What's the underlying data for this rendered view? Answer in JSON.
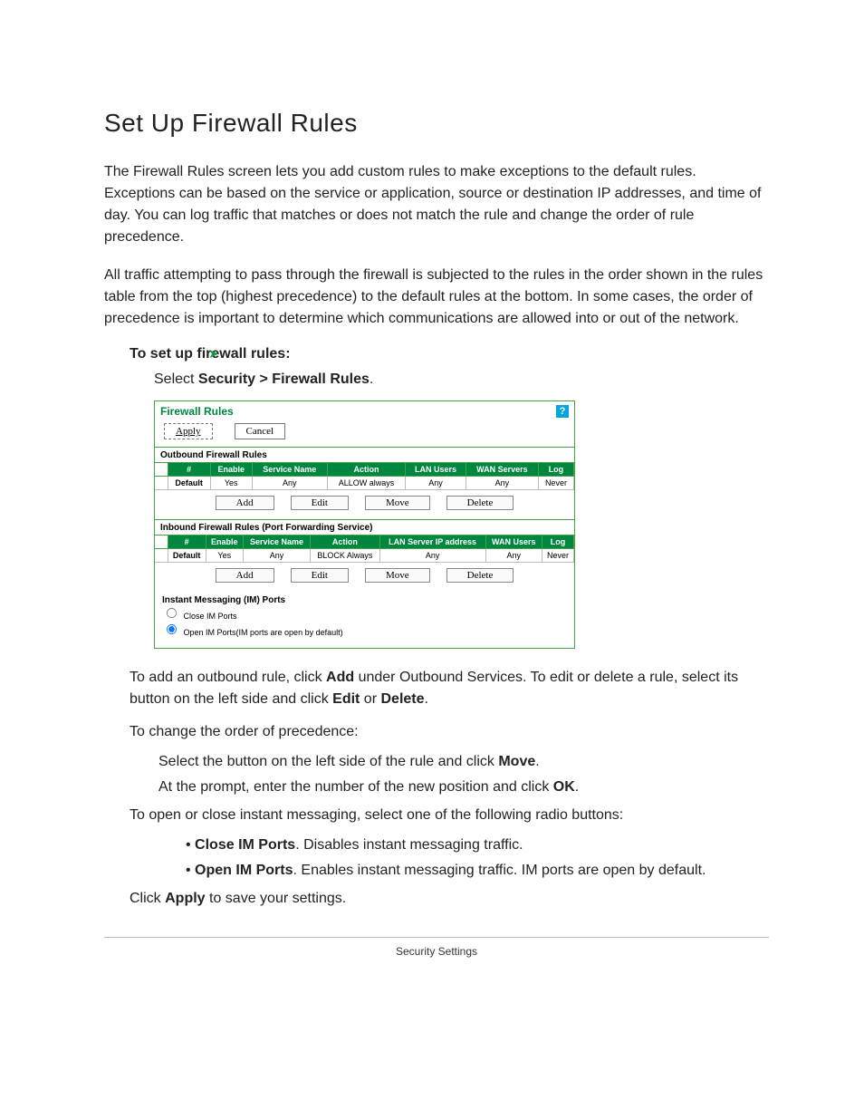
{
  "heading": "Set Up Firewall Rules",
  "intro1": "The Firewall Rules screen lets you add custom rules to make exceptions to the default rules. Exceptions can be based on the service or application, source or destination IP addresses, and time of day. You can log traffic that matches or does not match the rule and change the order of rule precedence.",
  "intro2": "All traffic attempting to pass through the firewall is subjected to the rules in the order shown in the rules table from the top (highest precedence) to the default rules at the bottom. In some cases, the order of precedence is important to determine which communications are allowed into or out of the network.",
  "proc_arrow": "➤",
  "proc_title": "To set up firewall rules:",
  "step1_prefix": "Select ",
  "step1_bold": "Security > Firewall Rules",
  "step1_suffix": ".",
  "shot": {
    "title": "Firewall Rules",
    "help": "?",
    "apply": "Apply",
    "cancel": "Cancel",
    "outbound_label": "Outbound Firewall Rules",
    "th_out": [
      "#",
      "Enable",
      "Service Name",
      "Action",
      "LAN Users",
      "WAN Servers",
      "Log"
    ],
    "row_out": [
      "Default",
      "Yes",
      "Any",
      "ALLOW always",
      "Any",
      "Any",
      "Never"
    ],
    "btns": {
      "add": "Add",
      "edit": "Edit",
      "move": "Move",
      "delete": "Delete"
    },
    "inbound_label": "Inbound Firewall Rules (Port Forwarding Service)",
    "th_in": [
      "#",
      "Enable",
      "Service Name",
      "Action",
      "LAN Server IP address",
      "WAN Users",
      "Log"
    ],
    "row_in": [
      "Default",
      "Yes",
      "Any",
      "BLOCK Always",
      "Any",
      "Any",
      "Never"
    ],
    "im_label": "Instant Messaging (IM) Ports",
    "im_close": "Close IM Ports",
    "im_open": "Open IM Ports(IM ports are open by default)"
  },
  "body": {
    "p1a": "To add an outbound rule, click ",
    "p1b": "Add",
    "p1c": " under Outbound Services. To edit or delete a rule, select its button on the left side and click ",
    "p1d": "Edit",
    "p1e": " or ",
    "p1f": "Delete",
    "p1g": ".",
    "p2": "To change the order of precedence:",
    "l1a": "Select the button on the left side of the rule and click ",
    "l1b": "Move",
    "l1c": ".",
    "l2a": "At the prompt, enter the number of the new position and click ",
    "l2b": "OK",
    "l2c": ".",
    "p3": "To open or close instant messaging, select one of the following radio buttons:",
    "b1a": "Close IM Ports",
    "b1b": ". Disables instant messaging traffic.",
    "b2a": "Open IM Ports",
    "b2b": ". Enables instant messaging traffic. IM ports are open by default.",
    "p4a": "Click ",
    "p4b": "Apply",
    "p4c": " to save your settings."
  },
  "footer": "Security Settings"
}
